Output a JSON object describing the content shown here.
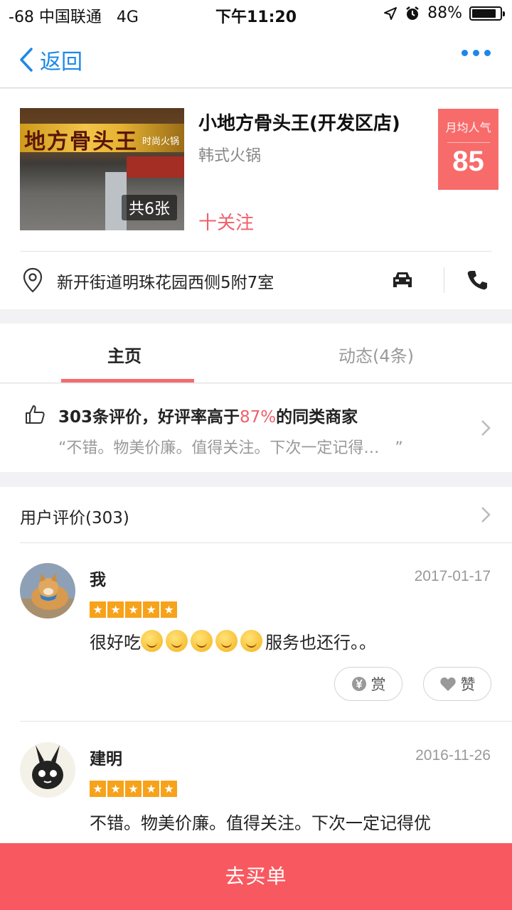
{
  "status_bar": {
    "carrier": "-68 中国联通",
    "network": "4G",
    "time": "下午11:20",
    "battery": "88%",
    "battery_level": 0.88
  },
  "nav": {
    "back_label": "返回",
    "accent_color": "#1c88e8",
    "icons": [
      "chevron-left-icon",
      "more-dots-icon"
    ]
  },
  "shop": {
    "name": "小地方骨头王(开发区店)",
    "category": "韩式火锅",
    "photo_sign": "地方骨头王",
    "photo_sign_sub": "时尚火锅",
    "photo_count": "共6张",
    "follow_label": "十关注",
    "popularity_label": "月均人气",
    "popularity_value": "85",
    "address": "新开街道明珠花园西侧5附7室"
  },
  "tabs": {
    "home": "主页",
    "feed": "动态(4条)"
  },
  "summary": {
    "prefix": "303条评价，好评率高于",
    "rate": "87%",
    "suffix": "的同类商家",
    "quote": "“不错。物美价廉。值得关注。下次一定记得…　”"
  },
  "user_reviews": {
    "header": "用户评价(303)",
    "items": [
      {
        "name": "我",
        "date": "2017-01-17",
        "rating": 5,
        "text_prefix": "很好吃",
        "text_suffix": "服务也还行。。",
        "reward_label": "赏",
        "like_label": "赞"
      },
      {
        "name": "建明",
        "date": "2016-11-26",
        "rating": 5,
        "text": "不错。物美价廉。值得关注。下次一定记得优"
      }
    ]
  },
  "cta": {
    "label": "去买单",
    "color": "#f8585f"
  }
}
